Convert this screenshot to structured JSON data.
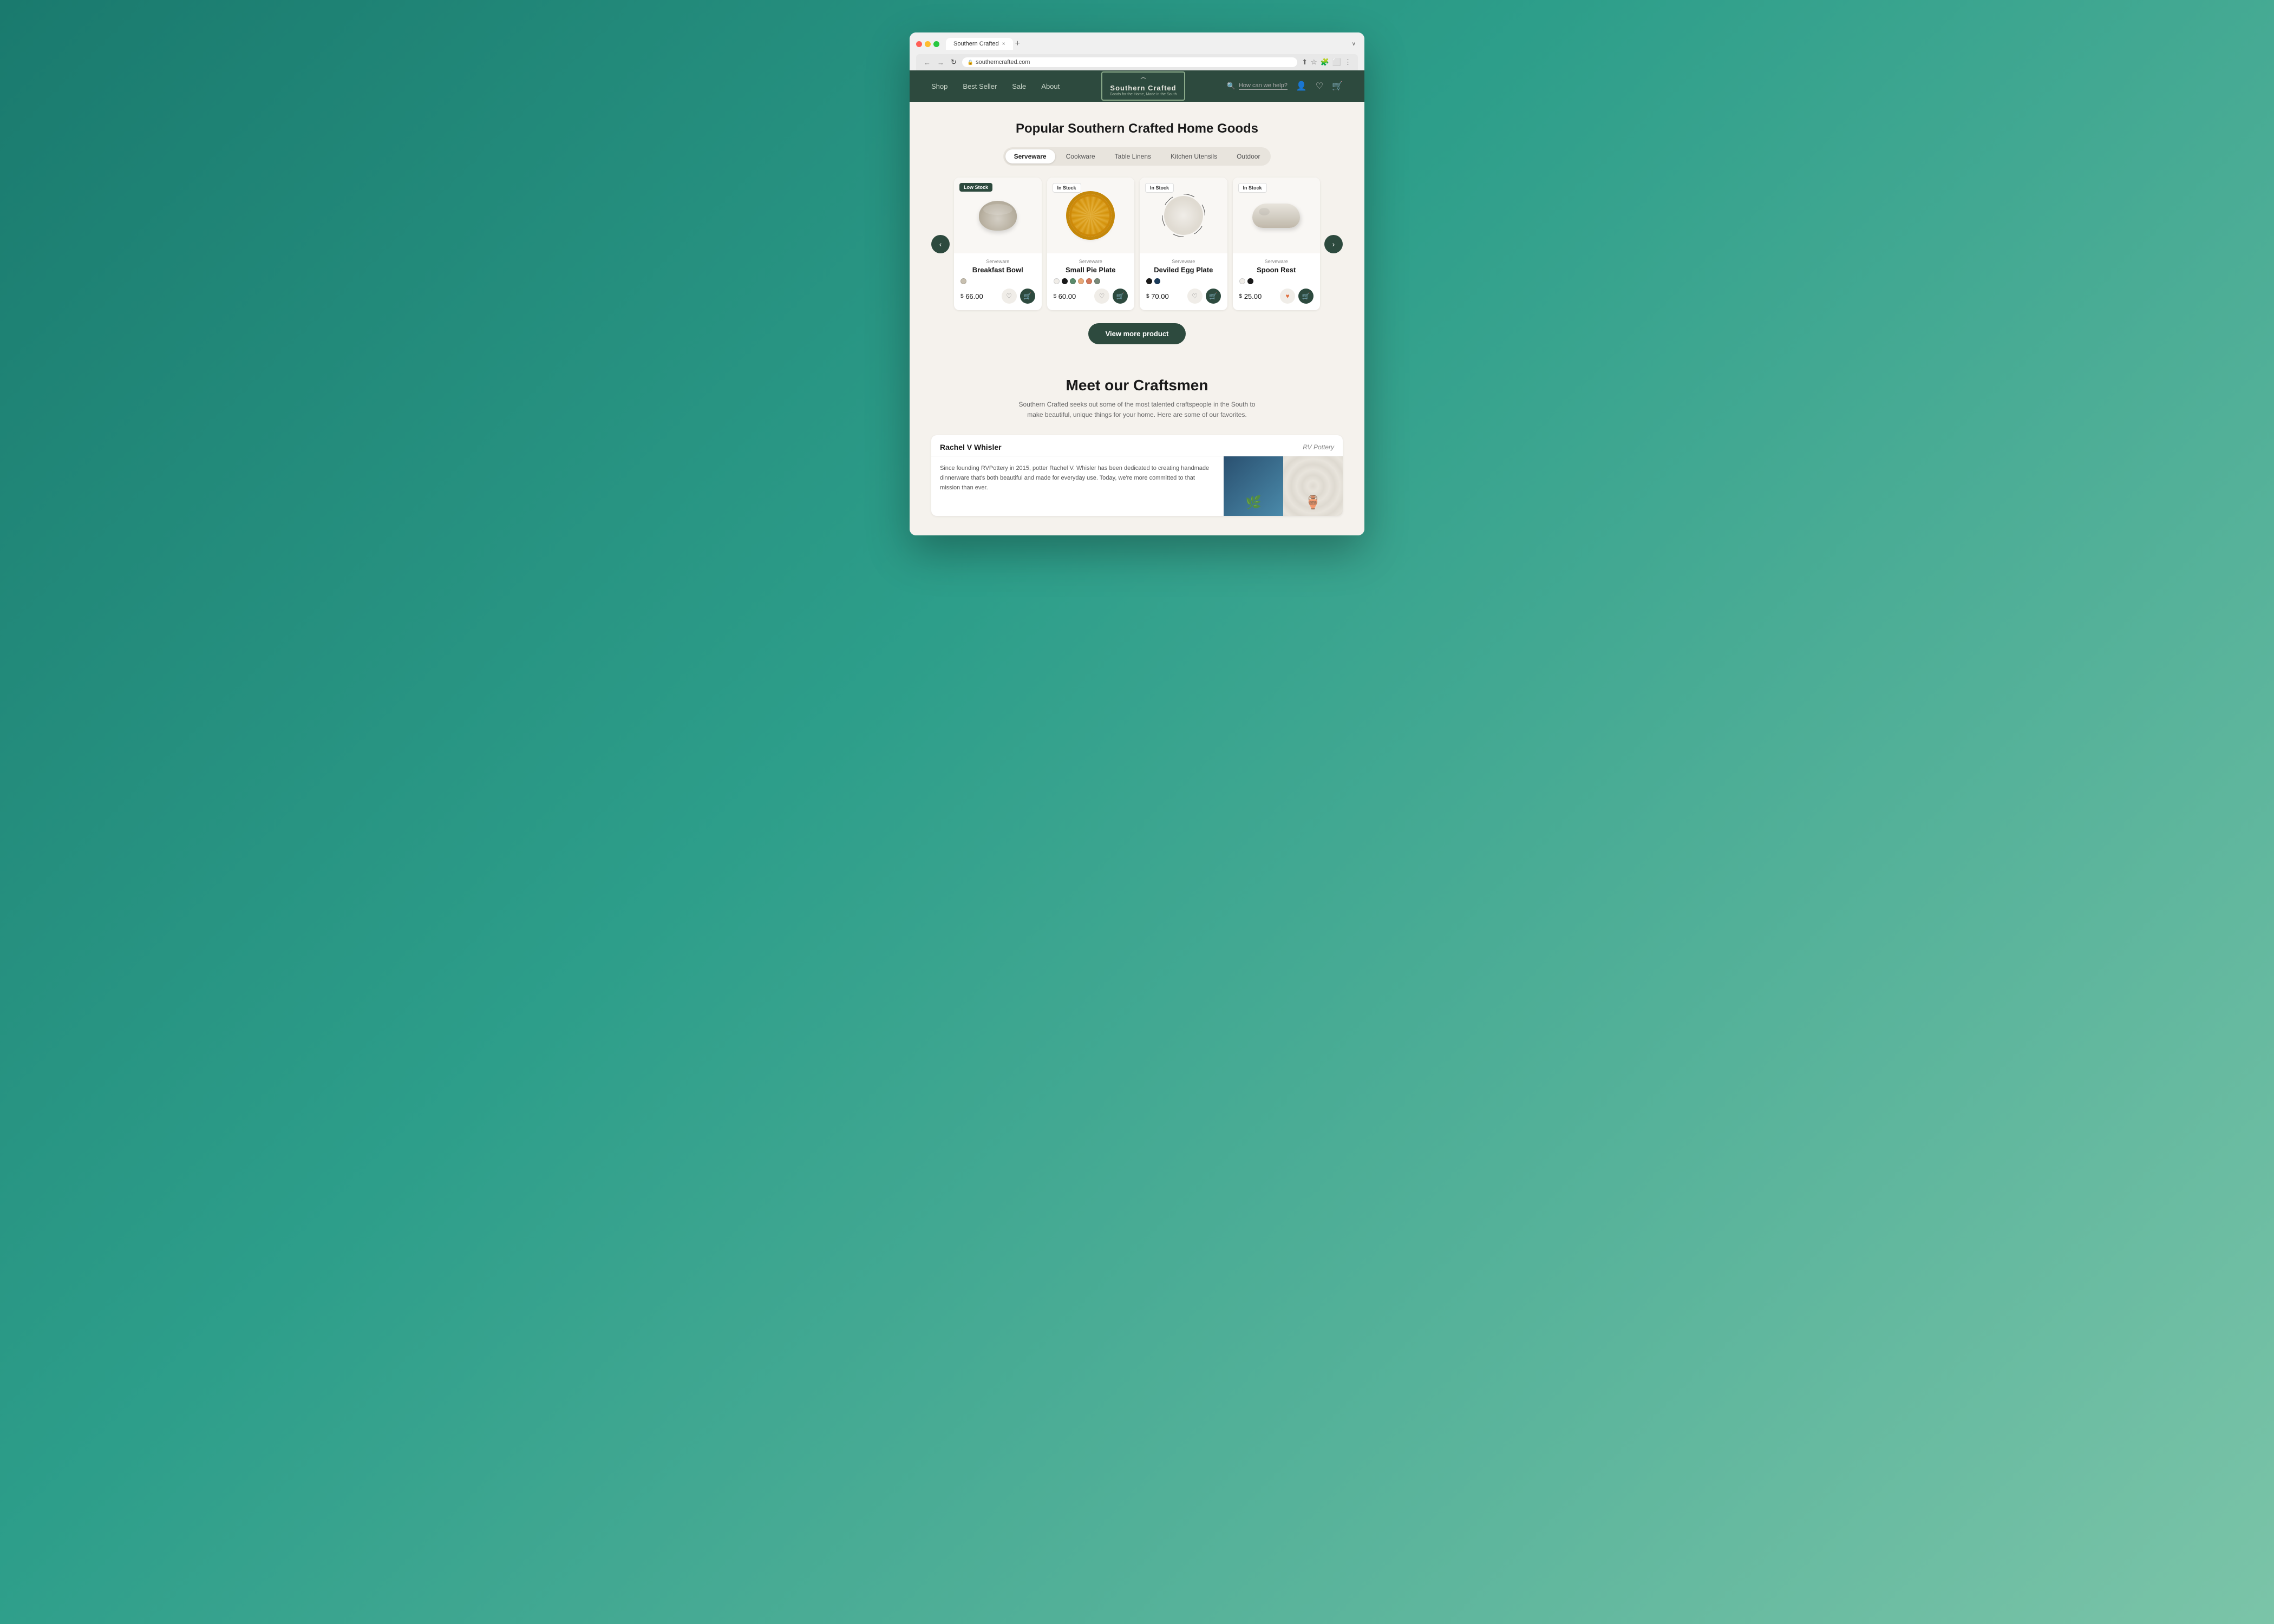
{
  "browser": {
    "tab_title": "Southern Crafted",
    "url": "southerncrafted.com",
    "new_tab": "+",
    "close_tab": "×",
    "chevron": "∨"
  },
  "nav": {
    "links": [
      "Shop",
      "Best Seller",
      "Sale",
      "About"
    ],
    "logo_main": "Southern Crafted",
    "logo_sub": "Goods for the Home, Made in the South",
    "search_placeholder": "How can we help?",
    "logo_bird": "⌒"
  },
  "products_section": {
    "title": "Popular Southern Crafted Home Goods",
    "categories": [
      "Serveware",
      "Cookware",
      "Table Linens",
      "Kitchen Utensils",
      "Outdoor"
    ],
    "active_category": "Serveware",
    "products": [
      {
        "name": "Breakfast Bowl",
        "category": "Serveware",
        "price": "66.00",
        "stock": "Low Stock",
        "stock_type": "low",
        "colors": [
          "#c8c0b0"
        ],
        "heart_active": false
      },
      {
        "name": "Small Pie Plate",
        "category": "Serveware",
        "price": "60.00",
        "stock": "In Stock",
        "stock_type": "in",
        "colors": [
          "#f0ede8",
          "#1a1a1a",
          "#5a8a6a",
          "#e8a878",
          "#d4785a",
          "#788878"
        ],
        "heart_active": false
      },
      {
        "name": "Deviled Egg Plate",
        "category": "Serveware",
        "price": "70.00",
        "stock": "In Stock",
        "stock_type": "in",
        "colors": [
          "#1a1a1a",
          "#1a3a5a"
        ],
        "heart_active": false
      },
      {
        "name": "Spoon Rest",
        "category": "Serveware",
        "price": "25.00",
        "stock": "In Stock",
        "stock_type": "in",
        "colors": [
          "#f0ede8",
          "#1a1a1a"
        ],
        "heart_active": true
      }
    ],
    "view_more_label": "View more product"
  },
  "craftsmen_section": {
    "title": "Meet our Craftsmen",
    "description": "Southern Crafted seeks out some of the most talented craftspeople in the South to make beautiful, unique things for your home. Here are some of our favorites.",
    "craftsman_name": "Rachel V Whisler",
    "craftsman_brand": "RV Pottery",
    "craftsman_bio": "Since founding RVPottery in 2015, potter Rachel V. Whisler has been dedicated to creating handmade dinnerware that's both beautiful and made for everyday use. Today, we're more committed to that mission than ever."
  }
}
